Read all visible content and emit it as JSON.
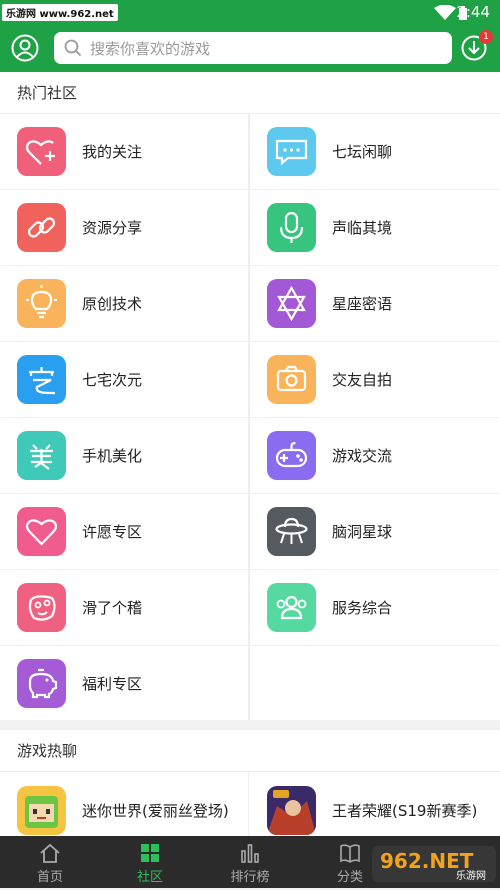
{
  "status": {
    "watermark": "乐游网 www.962.net",
    "time": "2:44"
  },
  "header": {
    "search_placeholder": "搜索你喜欢的游戏",
    "download_badge": "1"
  },
  "hot": {
    "title": "热门社区",
    "items": [
      {
        "label": "我的关注",
        "icon": "heart-plus-icon",
        "color": "#f0607a"
      },
      {
        "label": "七坛闲聊",
        "icon": "chat-bubble-icon",
        "color": "#5ec9ee"
      },
      {
        "label": "资源分享",
        "icon": "link-icon",
        "color": "#f0635c"
      },
      {
        "label": "声临其境",
        "icon": "microphone-icon",
        "color": "#36c47e"
      },
      {
        "label": "原创技术",
        "icon": "lightbulb-icon",
        "color": "#f9b45b"
      },
      {
        "label": "星座密语",
        "icon": "star-of-david-icon",
        "color": "#a358d6"
      },
      {
        "label": "七宅次元",
        "icon": "otaku-icon",
        "color": "#2a9ff0"
      },
      {
        "label": "交友自拍",
        "icon": "camera-icon",
        "color": "#f9b45b"
      },
      {
        "label": "手机美化",
        "icon": "beauty-icon",
        "color": "#3fc9b8"
      },
      {
        "label": "游戏交流",
        "icon": "gamepad-icon",
        "color": "#8a6cf0"
      },
      {
        "label": "许愿专区",
        "icon": "heart-icon",
        "color": "#f05c8e"
      },
      {
        "label": "脑洞星球",
        "icon": "ufo-icon",
        "color": "#555a60"
      },
      {
        "label": "滑了个稽",
        "icon": "funny-face-icon",
        "color": "#f06080"
      },
      {
        "label": "服务综合",
        "icon": "group-icon",
        "color": "#55d9a0"
      },
      {
        "label": "福利专区",
        "icon": "piggy-bank-icon",
        "color": "#a55bd6"
      }
    ]
  },
  "games": {
    "title": "游戏热聊",
    "items": [
      {
        "label": "迷你世界(爱丽丝登场)",
        "icon": "mini-world-icon"
      },
      {
        "label": "王者荣耀(S19新赛季)",
        "icon": "honor-of-kings-icon"
      }
    ]
  },
  "tabs": [
    {
      "label": "首页",
      "icon": "home-icon"
    },
    {
      "label": "社区",
      "icon": "grid-icon"
    },
    {
      "label": "排行榜",
      "icon": "bar-chart-icon"
    },
    {
      "label": "分类",
      "icon": "book-icon"
    }
  ],
  "footer_watermark": {
    "brand": "962.NET",
    "sub": "乐游网"
  }
}
